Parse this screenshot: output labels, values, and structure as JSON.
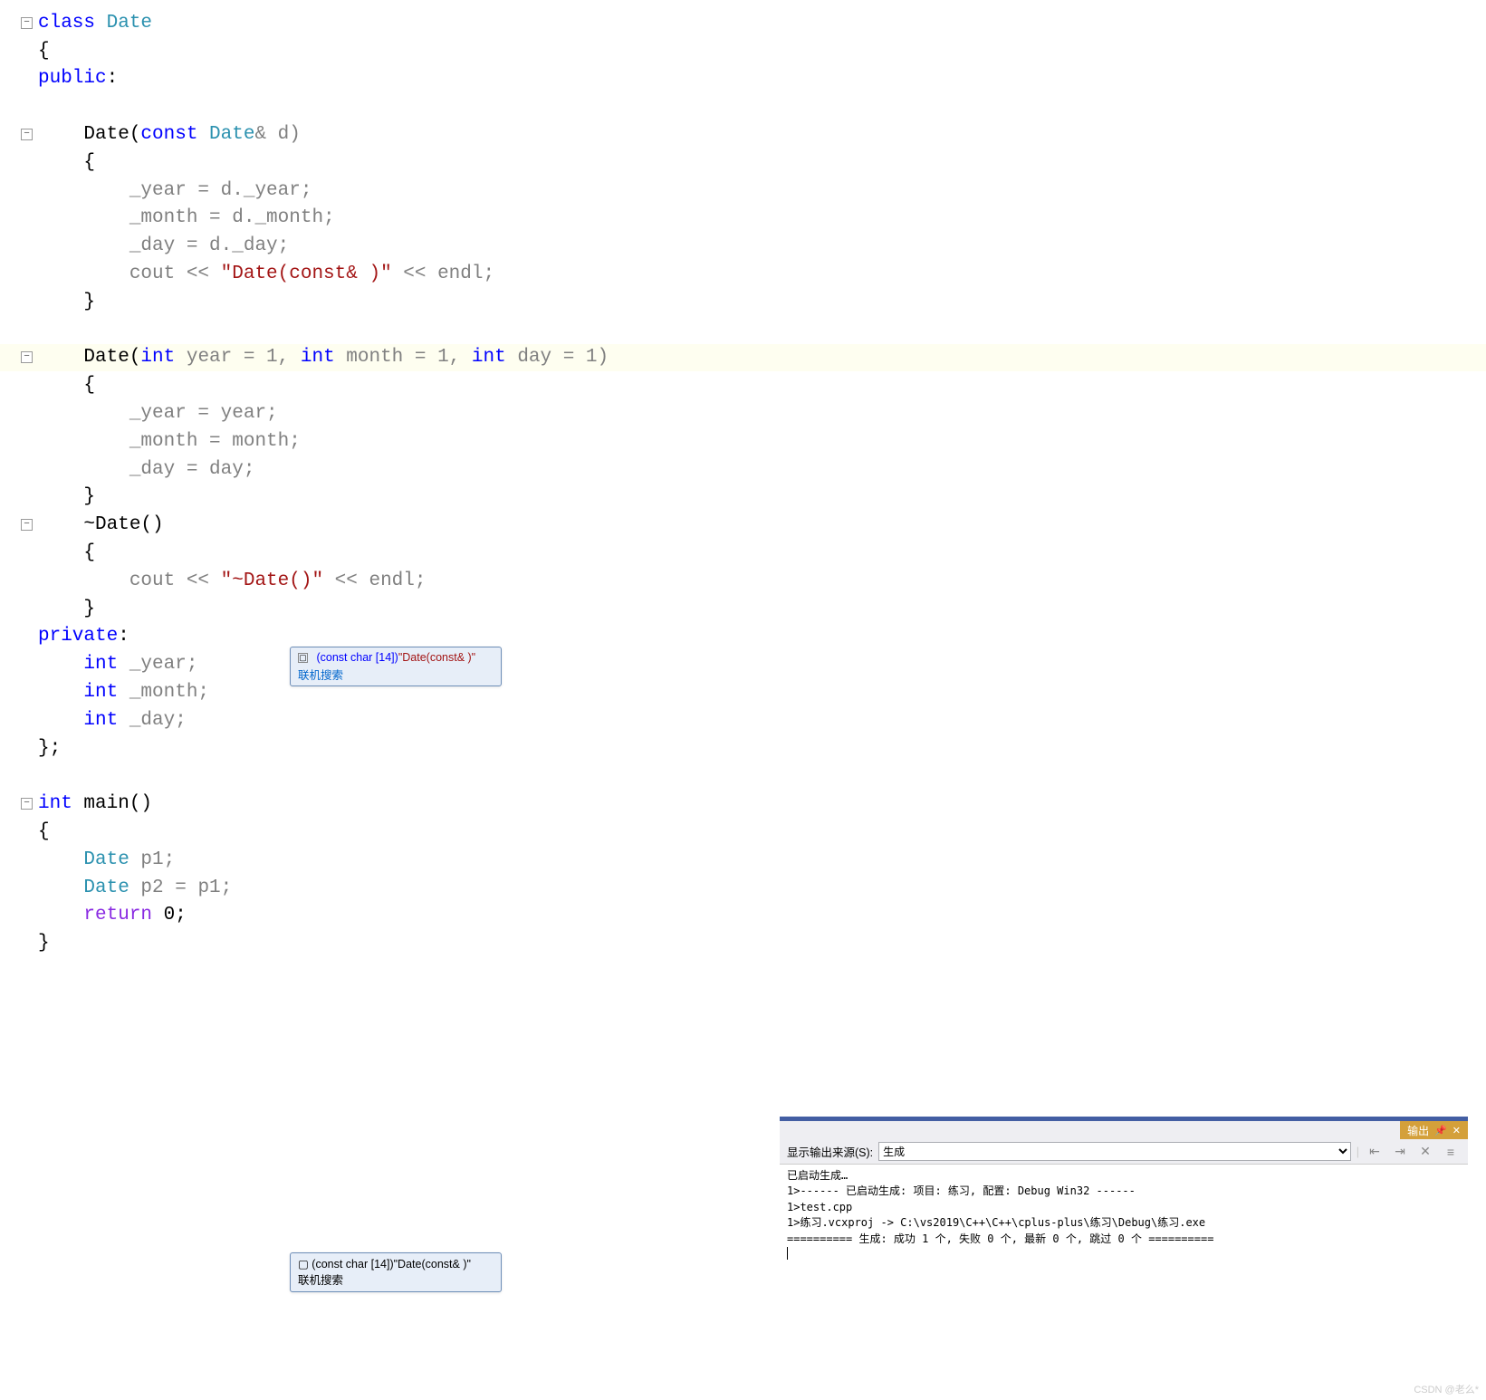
{
  "code": {
    "l1": "class",
    "l1b": " Date",
    "l2": "{",
    "l3a": "public",
    "l3b": ":",
    "l5a": "    Date(",
    "l5b": "const",
    "l5c": " Date",
    "l5d": "& d)",
    "l6": "    {",
    "l7a": "        _year = d._year;",
    "l8a": "        _month = d._month;",
    "l9a": "        _day = d._day;",
    "l10a": "        cout << ",
    "l10b": "\"Date(const& )\"",
    "l10c": " << endl;",
    "l11": "    }",
    "l13a": "    Date(",
    "l13b": "int",
    "l13c": " year = 1, ",
    "l13d": "int",
    "l13e": " month = 1, ",
    "l13f": "int",
    "l13g": " day = 1)",
    "l14": "    {",
    "l15": "        _year = year;",
    "l16": "        _month = month;",
    "l17": "        _day = day;",
    "l18": "    }",
    "l19a": "    ~Date()",
    "l20": "    {",
    "l21a": "        cout << ",
    "l21b": "\"~Date()\"",
    "l21c": " << endl;",
    "l22": "    }",
    "l23a": "private",
    "l23b": ":",
    "l24a": "    int",
    "l24b": " _year;",
    "l25a": "    int",
    "l25b": " _month;",
    "l26a": "    int",
    "l26b": " _day;",
    "l27": "};",
    "l29a": "int",
    "l29b": " main()",
    "l30": "{",
    "l31a": "    Date",
    "l31b": " p1;",
    "l32a": "    Date",
    "l32b": " p2 = p1;",
    "l33a": "    return",
    "l33b": " 0;",
    "l34": "}"
  },
  "tooltip": {
    "type_blue": "(const char [14])",
    "type_red": "\"Date(const& )\"",
    "link": "联机搜索"
  },
  "output": {
    "tab_label": "输出",
    "source_label": "显示输出来源(S):",
    "source_value": "生成",
    "line1": "已启动生成…",
    "line2": "1>------ 已启动生成: 项目: 练习, 配置: Debug Win32 ------",
    "line3": "1>test.cpp",
    "line4": "1>练习.vcxproj -> C:\\vs2019\\C++\\C++\\cplus-plus\\练习\\Debug\\练习.exe",
    "line5": "========== 生成: 成功 1 个, 失败 0 个, 最新 0 个, 跳过 0 个 =========="
  },
  "watermark": "CSDN @老么*"
}
